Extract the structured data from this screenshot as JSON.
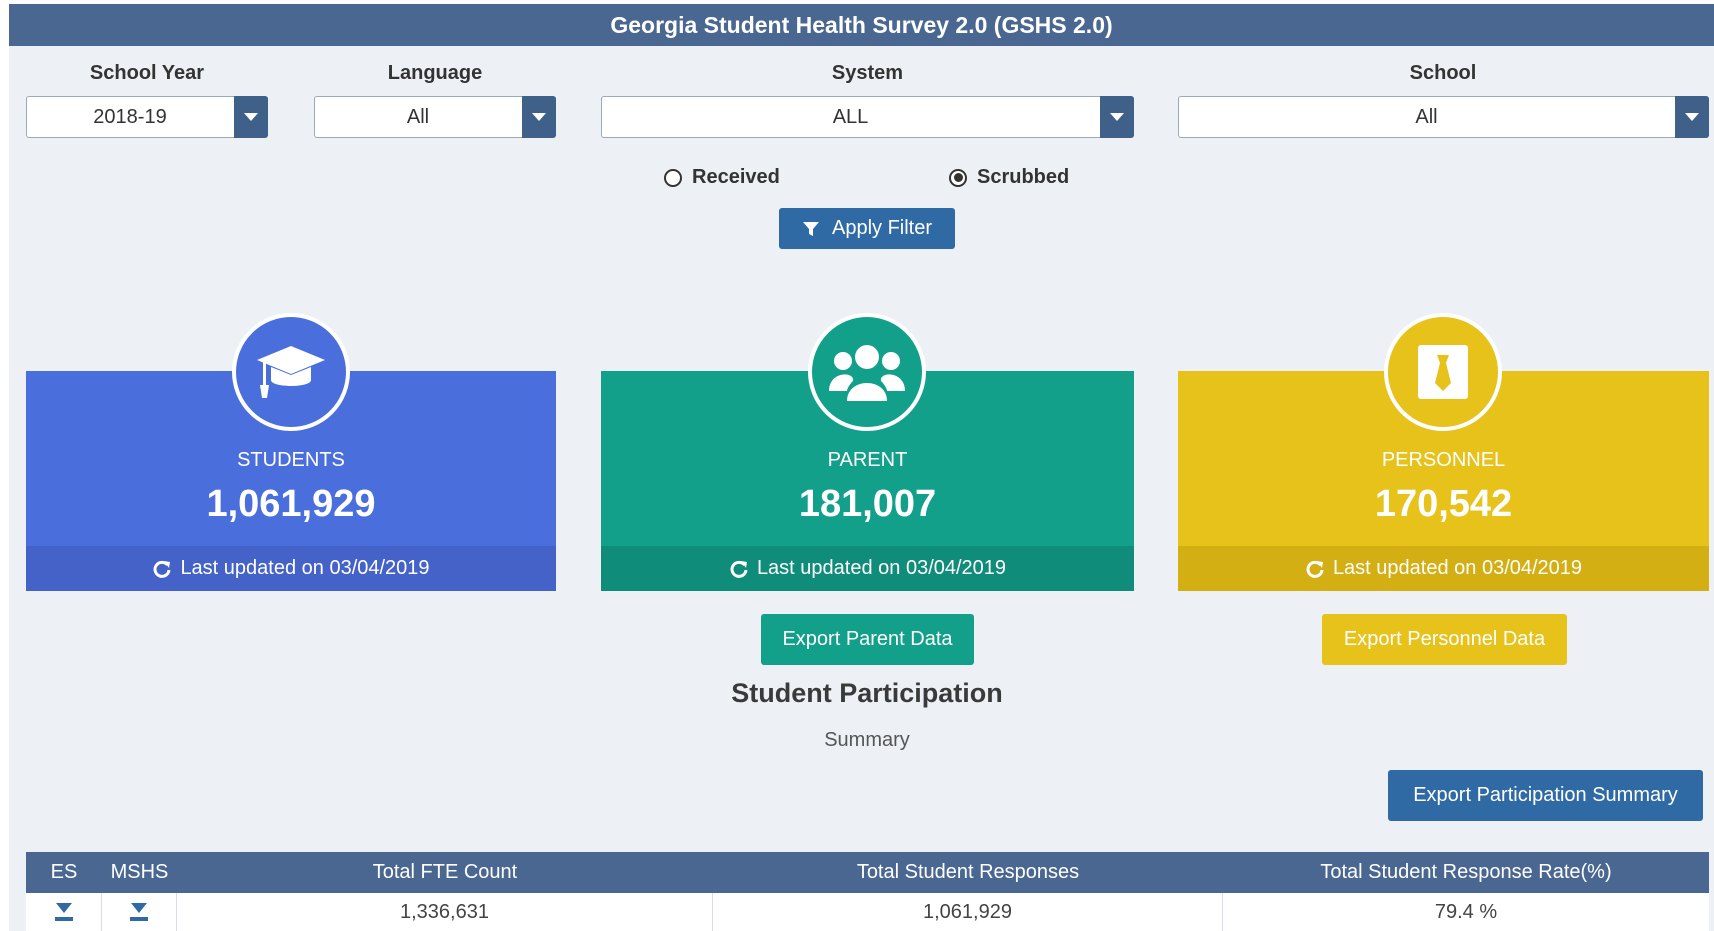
{
  "title": "Georgia Student Health Survey 2.0 (GSHS 2.0)",
  "filters": {
    "school_year": {
      "label": "School Year",
      "value": "2018-19"
    },
    "language": {
      "label": "Language",
      "value": "All"
    },
    "system": {
      "label": "System",
      "value": "ALL"
    },
    "school": {
      "label": "School",
      "value": "All"
    }
  },
  "radios": {
    "received": {
      "label": "Received",
      "selected": false
    },
    "scrubbed": {
      "label": "Scrubbed",
      "selected": true
    }
  },
  "apply_label": "Apply Filter",
  "cards": [
    {
      "label": "STUDENTS",
      "value": "1,061,929",
      "updated": "Last updated on 03/04/2019",
      "color": "#4a6fdc",
      "footer_color": "#4462c8",
      "icon": "graduation-cap-icon"
    },
    {
      "label": "PARENT",
      "value": "181,007",
      "updated": "Last updated on 03/04/2019",
      "color": "#13a08b",
      "footer_color": "#0f8d7a",
      "icon": "users-icon"
    },
    {
      "label": "PERSONNEL",
      "value": "170,542",
      "updated": "Last updated on 03/04/2019",
      "color": "#e6c21a",
      "footer_color": "#d3af14",
      "icon": "id-badge-icon"
    }
  ],
  "export_parent": "Export Parent Data",
  "export_personnel": "Export Personnel Data",
  "section_title": "Student Participation",
  "section_sub": "Summary",
  "export_summary": "Export Participation Summary",
  "table": {
    "headers": [
      "ES",
      "MSHS",
      "Total FTE Count",
      "Total Student Responses",
      "Total Student Response Rate(%)"
    ],
    "row": {
      "fte": "1,336,631",
      "responses": "1,061,929",
      "rate": "79.4 %"
    }
  }
}
